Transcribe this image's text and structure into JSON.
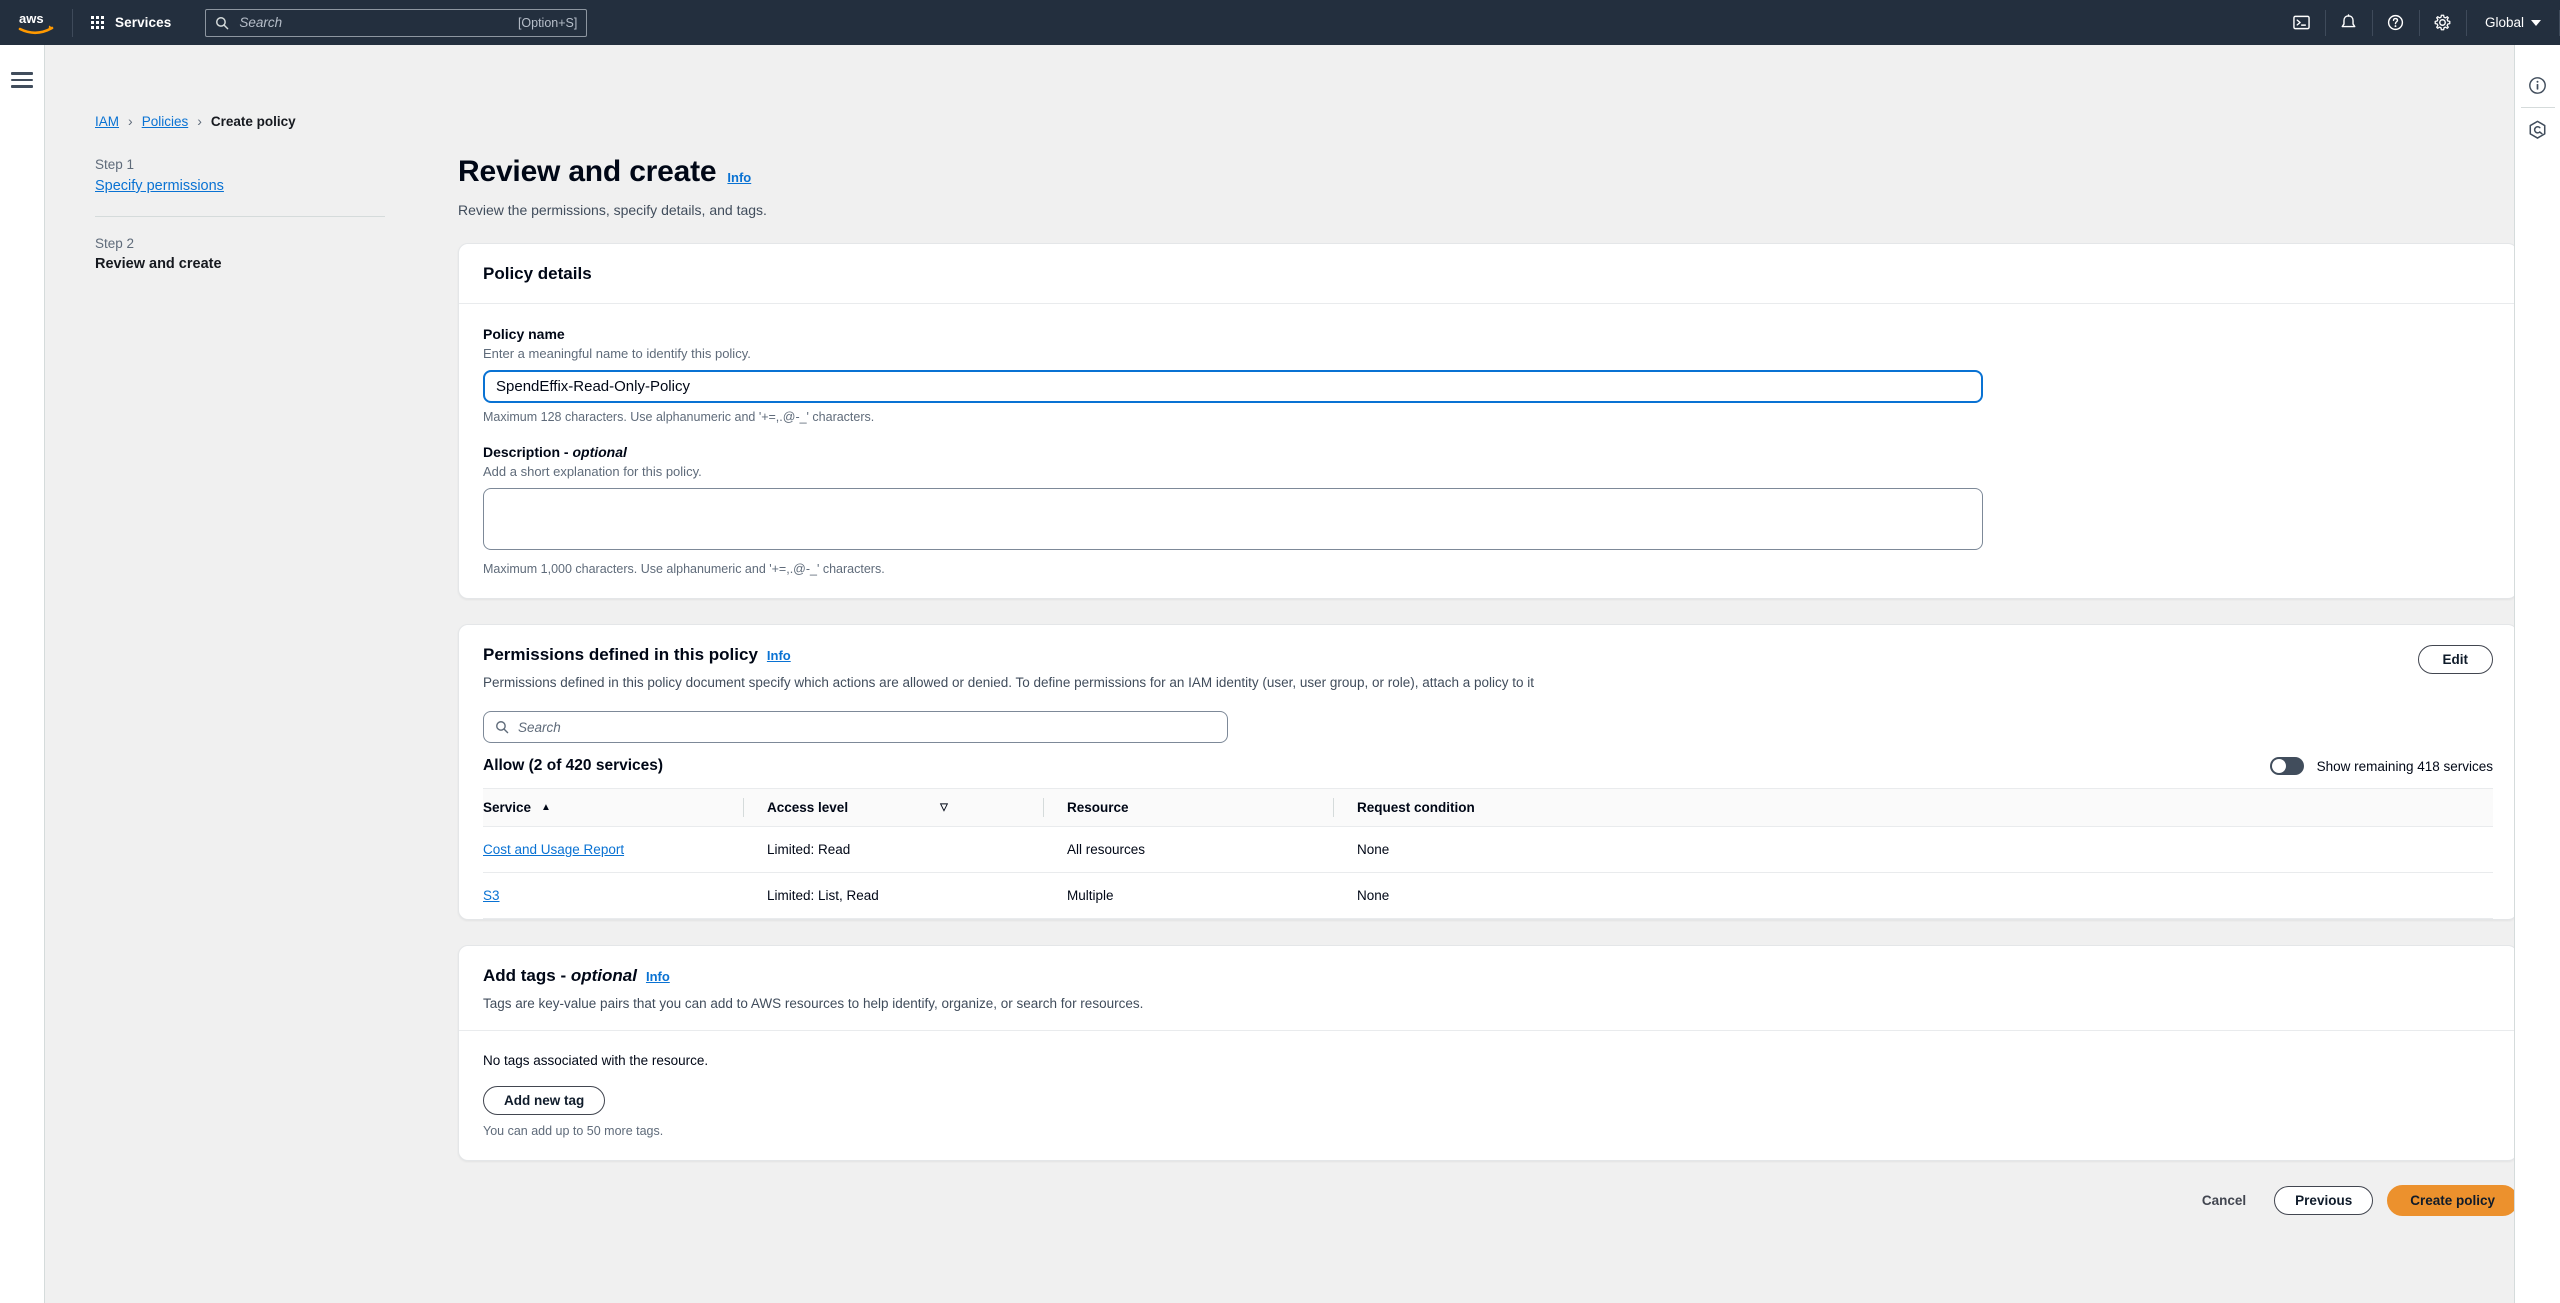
{
  "topnav": {
    "logo_alt": "aws",
    "services_label": "Services",
    "search_placeholder": "Search",
    "search_shortcut": "[Option+S]",
    "icons": [
      "cloudshell-icon",
      "notifications-bell-icon",
      "help-question-icon",
      "settings-gear-icon"
    ],
    "region_label": "Global",
    "accent_orange": "#ff9900",
    "nav_background": "#232f3e"
  },
  "breadcrumb": {
    "items": [
      {
        "label": "IAM",
        "link": true
      },
      {
        "label": "Policies",
        "link": true
      },
      {
        "label": "Create policy",
        "link": false
      }
    ],
    "separator": "›"
  },
  "steps": [
    {
      "number": "Step 1",
      "label": "Specify permissions",
      "active": false
    },
    {
      "number": "Step 2",
      "label": "Review and create",
      "active": true
    }
  ],
  "page": {
    "title": "Review and create",
    "info_label": "Info",
    "subtitle": "Review the permissions, specify details, and tags."
  },
  "policy_details": {
    "card_title": "Policy details",
    "name_label": "Policy name",
    "name_hint": "Enter a meaningful name to identify this policy.",
    "name_value": "SpendEffix-Read-Only-Policy",
    "name_foot": "Maximum 128 characters. Use alphanumeric and '+=,.@-_' characters.",
    "description_label": "Description - ",
    "description_label_optional": "optional",
    "description_hint": "Add a short explanation for this policy.",
    "description_value": "",
    "description_placeholder": "",
    "description_foot": "Maximum 1,000 characters. Use alphanumeric and '+=,.@-_' characters."
  },
  "permissions": {
    "card_title": "Permissions defined in this policy",
    "info_label": "Info",
    "edit_label": "Edit",
    "description": "Permissions defined in this policy document specify which actions are allowed or denied. To define permissions for an IAM identity (user, user group, or role), attach a policy to it",
    "search_placeholder": "Search",
    "allow_heading": "Allow (2 of 420 services)",
    "toggle_label": "Show remaining 418 services",
    "toggle_on": false,
    "columns": [
      {
        "label": "Service",
        "sort": "ascending"
      },
      {
        "label": "Access level",
        "sort": "descending"
      },
      {
        "label": "Resource",
        "sort": "none"
      },
      {
        "label": "Request condition",
        "sort": "none"
      }
    ],
    "rows": [
      {
        "service": "Cost and Usage Report",
        "access_level": "Limited: Read",
        "resource": "All resources",
        "request_condition": "None"
      },
      {
        "service": "S3",
        "access_level": "Limited: List, Read",
        "resource": "Multiple",
        "request_condition": "None"
      }
    ]
  },
  "tags": {
    "card_title": "Add tags - ",
    "card_title_optional": "optional",
    "info_label": "Info",
    "description": "Tags are key-value pairs that you can add to AWS resources to help identify, organize, or search for resources.",
    "empty_text": "No tags associated with the resource.",
    "add_button": "Add new tag",
    "foot_text": "You can add up to 50 more tags."
  },
  "footer": {
    "cancel": "Cancel",
    "previous": "Previous",
    "create": "Create policy",
    "primary_color": "#ec912d"
  },
  "right_rail": {
    "icons": [
      "info-circle-icon",
      "aws-q-hexagon-icon"
    ]
  }
}
